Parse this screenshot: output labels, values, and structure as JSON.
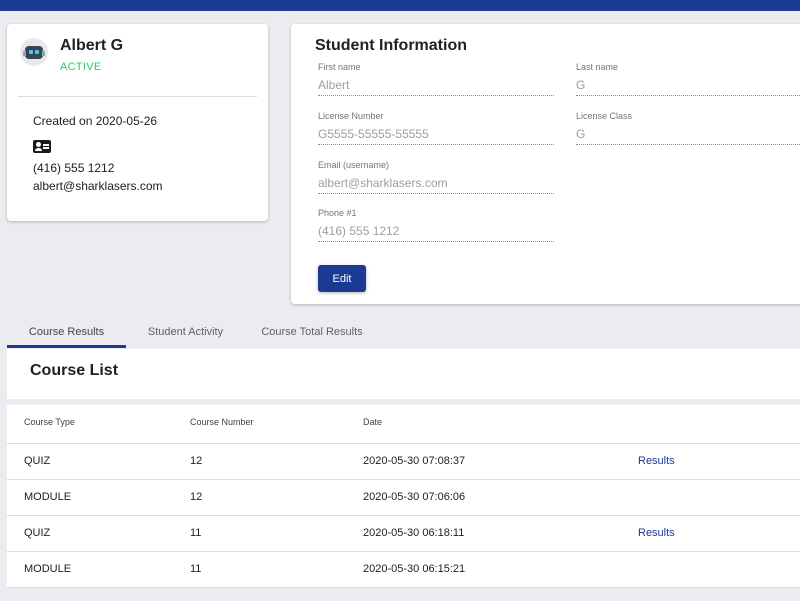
{
  "profile": {
    "name": "Albert G",
    "status": "ACTIVE",
    "created": "Created on 2020-05-26",
    "phone": "(416) 555 1212",
    "email": "albert@sharklasers.com",
    "icons": {
      "avatar": "robot-avatar-icon",
      "id": "id-card-icon"
    }
  },
  "info": {
    "title": "Student Information",
    "first_name": {
      "label": "First name",
      "value": "Albert"
    },
    "last_name": {
      "label": "Last name",
      "value": "G"
    },
    "license_number": {
      "label": "License Number",
      "value": "G5555-55555-55555"
    },
    "license_class": {
      "label": "License Class",
      "value": "G"
    },
    "email": {
      "label": "Email (username)",
      "value": "albert@sharklasers.com"
    },
    "phone": {
      "label": "Phone #1",
      "value": "(416) 555 1212"
    },
    "edit_label": "Edit"
  },
  "tabs": [
    {
      "label": "Course Results",
      "active": true
    },
    {
      "label": "Student Activity",
      "active": false
    },
    {
      "label": "Course Total Results",
      "active": false
    }
  ],
  "course_list": {
    "title": "Course List",
    "columns": [
      "Course Type",
      "Course Number",
      "Date"
    ],
    "rows": [
      {
        "type": "QUIZ",
        "number": "12",
        "date": "2020-05-30 07:08:37",
        "action": "Results"
      },
      {
        "type": "MODULE",
        "number": "12",
        "date": "2020-05-30 07:06:06",
        "action": ""
      },
      {
        "type": "QUIZ",
        "number": "11",
        "date": "2020-05-30 06:18:11",
        "action": "Results"
      },
      {
        "type": "MODULE",
        "number": "11",
        "date": "2020-05-30 06:15:21",
        "action": ""
      }
    ]
  },
  "colors": {
    "primary": "#1a3a94",
    "active_status": "#2ecc52",
    "background": "#eaecef"
  }
}
